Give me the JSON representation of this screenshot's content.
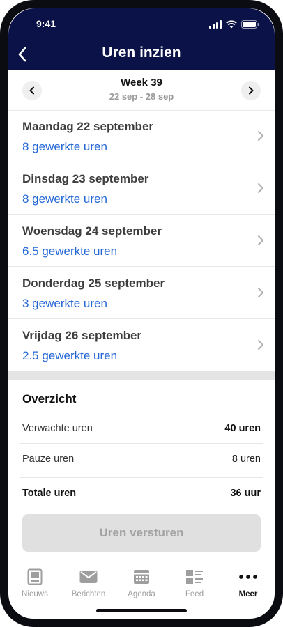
{
  "status_bar": {
    "time": "9:41"
  },
  "header": {
    "title": "Uren inzien"
  },
  "week": {
    "title": "Week 39",
    "range": "22 sep - 28 sep"
  },
  "days": [
    {
      "name": "Maandag 22 september",
      "hours": "8 gewerkte uren"
    },
    {
      "name": "Dinsdag 23 september",
      "hours": "8 gewerkte uren"
    },
    {
      "name": "Woensdag 24 september",
      "hours": "6.5 gewerkte uren"
    },
    {
      "name": "Donderdag 25 september",
      "hours": "3 gewerkte uren"
    },
    {
      "name": "Vrijdag 26 september",
      "hours": "2.5 gewerkte uren"
    }
  ],
  "overview": {
    "heading": "Overzicht",
    "rows": [
      {
        "label": "Verwachte uren",
        "value": "40 uren"
      },
      {
        "label": "Pauze uren",
        "value": "8 uren"
      },
      {
        "label": "Totale uren",
        "value": "36 uur"
      }
    ]
  },
  "send_button": {
    "label": "Uren versturen",
    "state": "disabled"
  },
  "tabbar": {
    "tabs": [
      {
        "label": "Nieuws",
        "icon": "news-icon"
      },
      {
        "label": "Berichten",
        "icon": "mail-icon"
      },
      {
        "label": "Agenda",
        "icon": "calendar-icon"
      },
      {
        "label": "Feed",
        "icon": "feed-icon"
      },
      {
        "label": "Meer",
        "icon": "more-icon",
        "active": true
      }
    ]
  },
  "colors": {
    "header_bg": "#0a1247",
    "link_blue": "#2366d6",
    "disabled_button": "#e0e0e0"
  }
}
